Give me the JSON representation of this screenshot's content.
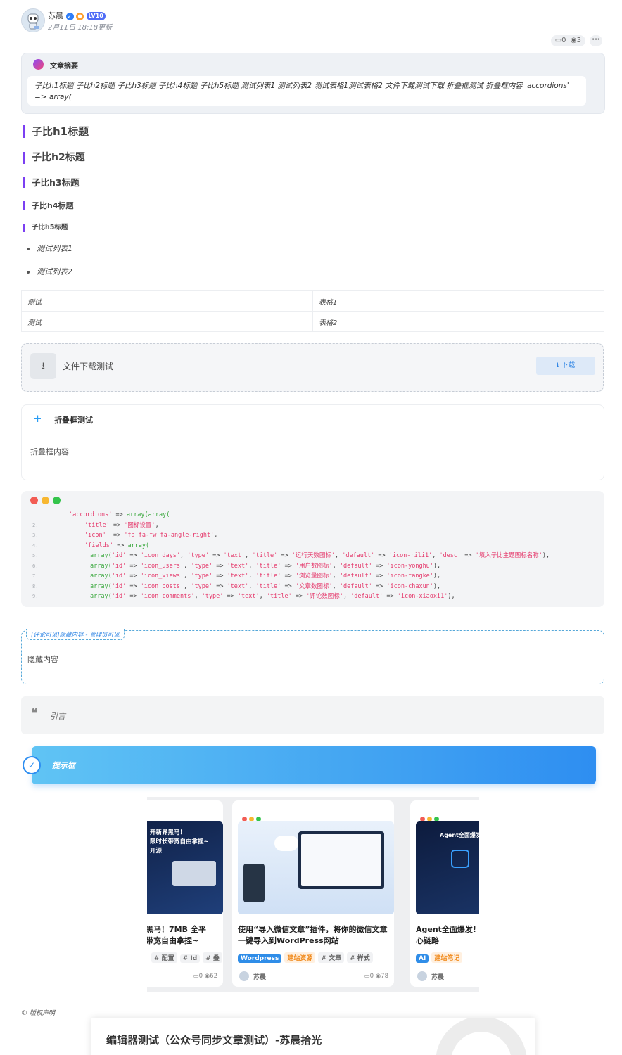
{
  "author": {
    "name": "苏晨",
    "level": "10",
    "updated": "2月11日 18:18更新"
  },
  "meta": {
    "comments": "0",
    "views": "3",
    "more": "···"
  },
  "summary": {
    "title": "文章摘要",
    "text": "子比h1标题 子比h2标题 子比h3标题 子比h4标题 子比h5标题 测试列表1 测试列表2 测试表格1测试表格2 文件下载测试下载 折叠框测试 折叠框内容 'accordions' => array("
  },
  "headings": {
    "h1": "子比h1标题",
    "h2": "子比h2标题",
    "h3": "子比h3标题",
    "h4": "子比h4标题",
    "h5": "子比h5标题"
  },
  "list": [
    "测试列表1",
    "测试列表2"
  ],
  "table": [
    [
      "测试",
      "表格1"
    ],
    [
      "测试",
      "表格2"
    ]
  ],
  "download": {
    "label": "文件下载测试",
    "button": "下载"
  },
  "accordion": {
    "title": "折叠框测试",
    "content": "折叠框内容"
  },
  "code": {
    "line_numbers": [
      "1.",
      "2.",
      "3.",
      "4.",
      "5.",
      "6.",
      "7.",
      "8.",
      "9."
    ],
    "line1": {
      "key": "'accordions'",
      "op": " => ",
      "fn": "array(array("
    },
    "line2": {
      "key": "'title'",
      "op": " => ",
      "val": "'图标设置'",
      "end": ","
    },
    "line3": {
      "key": "'icon'",
      "op": "  => ",
      "val": "'fa fa-fw fa-angle-right'",
      "end": ","
    },
    "line4": {
      "key": "'fields'",
      "op": " => ",
      "fn": "array("
    },
    "arrays": [
      {
        "id": "'icon_days'",
        "title": "'运行天数图标'",
        "default": "'icon-rili1'",
        "desc": "'填入子比主题图标名称'"
      },
      {
        "id": "'icon_users'",
        "title": "'用户数图标'",
        "default": "'icon-yonghu'"
      },
      {
        "id": "'icon_views'",
        "title": "'浏览量图标'",
        "default": "'icon-fangke'"
      },
      {
        "id": "'icon_posts'",
        "title": "'文章数图标'",
        "default": "'icon-chaxun'"
      },
      {
        "id": "'icon_comments'",
        "title": "'评论数图标'",
        "default": "'icon-xiaoxi1'"
      }
    ]
  },
  "hidden": {
    "tag": "[评论可见]隐藏内容 - 管理员可见",
    "content": "隐藏内容"
  },
  "quote": {
    "text": "引言"
  },
  "tip": {
    "text": "提示框"
  },
  "cards": [
    {
      "image_caption": "开新界黑马！\n限时长带宽自由拿捏~\n开源",
      "title": "黑马！7MB 全平\n带宽自由拿捏~",
      "tags": [
        "# 配置",
        "# Id",
        "# 叠"
      ],
      "comments": "0",
      "views": "62"
    },
    {
      "title": "使用“导入微信文章”插件，将你的微信文章一键导入到WordPress网站",
      "tags": [
        "Wordpress",
        "建站资源",
        "# 文章",
        "# 样式"
      ],
      "author": "苏晨",
      "comments": "0",
      "views": "78"
    },
    {
      "image_caption": "Agent全面爆发!",
      "title": "Agent全面爆发!\n心链路",
      "tags": [
        "AI",
        "建站笔记"
      ],
      "author": "苏晨"
    }
  ],
  "copyright": {
    "label": "© 版权声明",
    "title": "编辑器测试（公众号同步文章测试）-苏晨拾光"
  },
  "colors": {
    "accent_blue": "#2e8ef1",
    "heading_bar": "#7b3ff2",
    "code_key": "#e5386b",
    "code_fn": "#3aa83e"
  }
}
